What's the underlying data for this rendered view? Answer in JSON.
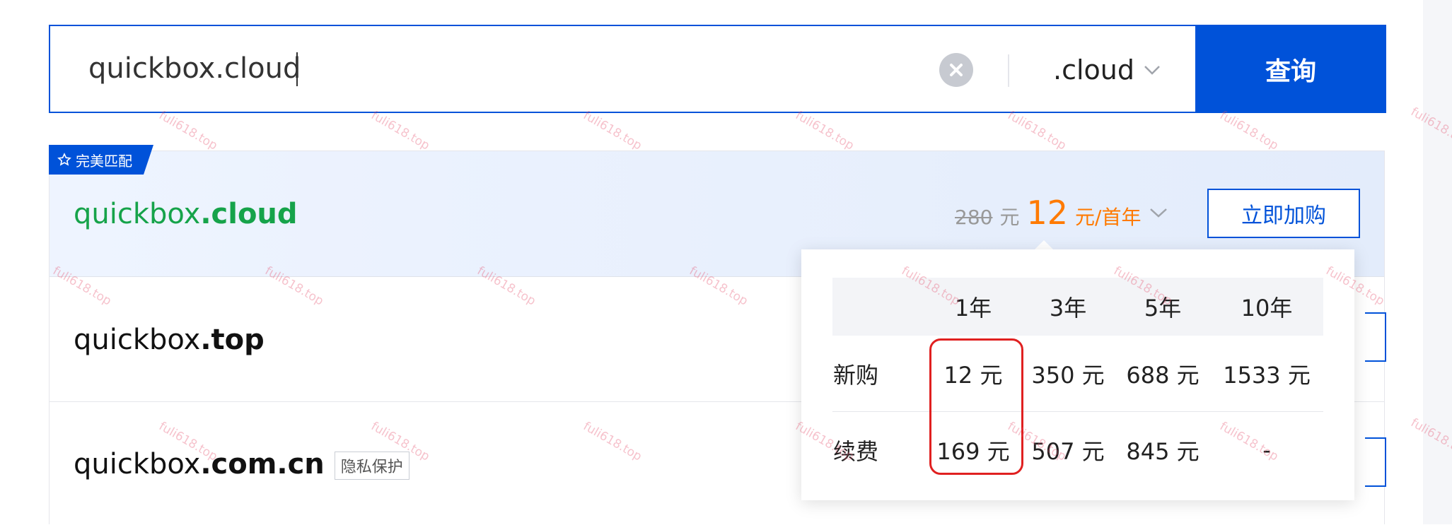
{
  "search": {
    "value": "quickbox.cloud",
    "suffix": ".cloud",
    "query_label": "查询"
  },
  "results": [
    {
      "badge": "完美匹配",
      "name": "quickbox",
      "tld": ".cloud",
      "original_price": "280",
      "original_unit": "元",
      "price": "12",
      "price_unit": "元/首年",
      "buy_label": "立即加购"
    },
    {
      "name": "quickbox",
      "tld": ".top"
    },
    {
      "name": "quickbox",
      "tld": ".com.cn",
      "tag": "隐私保护"
    }
  ],
  "price_popup": {
    "headers": [
      "",
      "1年",
      "3年",
      "5年",
      "10年"
    ],
    "rows": [
      {
        "label": "新购",
        "values": [
          "12 元",
          "350 元",
          "688 元",
          "1533 元"
        ]
      },
      {
        "label": "续费",
        "values": [
          "169 元",
          "507 元",
          "845 元",
          "-"
        ]
      }
    ]
  },
  "watermark": "fuli618.top",
  "colors": {
    "primary": "#0052d9",
    "match_green": "#16a34a",
    "price_orange": "#ff7a00",
    "highlight_red": "#e02020"
  }
}
